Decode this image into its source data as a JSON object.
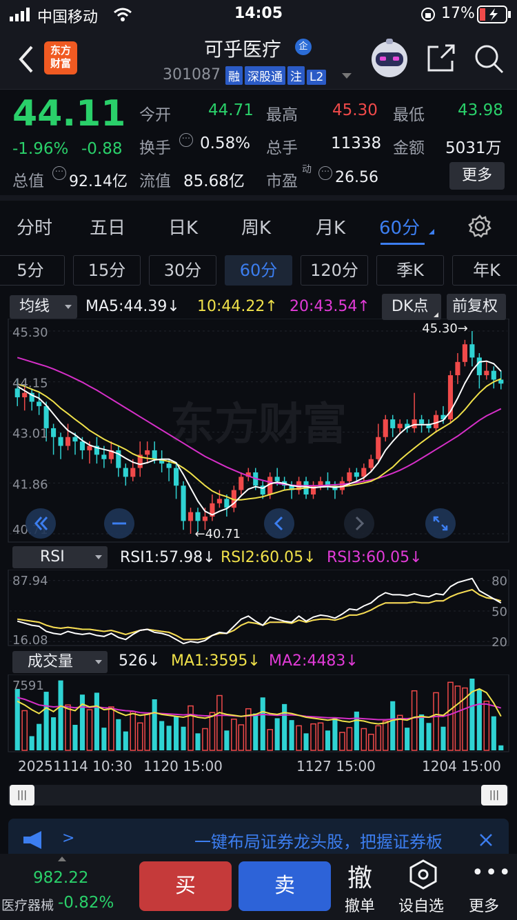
{
  "status_bar": {
    "carrier": "中国移动",
    "time": "14:05",
    "battery": "17%"
  },
  "header": {
    "back_icon": "chevron-left-icon",
    "logo_text": "东方\n财富",
    "stock_name": "可乎医疗",
    "name_badge": "企",
    "stock_code": "301087",
    "badges": [
      "融",
      "深股通",
      "注",
      "L2"
    ]
  },
  "quote": {
    "price": "44.11",
    "change_pct": "-1.96%",
    "change_amt": "-0.88",
    "fields": [
      {
        "label": "今开",
        "value": "44.71",
        "color": "green"
      },
      {
        "label": "最高",
        "value": "45.30",
        "color": "red"
      },
      {
        "label": "最低",
        "value": "43.98",
        "color": "green"
      },
      {
        "label": "换手",
        "value": "0.58%",
        "color": "white"
      },
      {
        "label": "总手",
        "value": "11338",
        "color": "white"
      },
      {
        "label": "金额",
        "value": "5031万",
        "color": "white"
      },
      {
        "label": "总值",
        "value": "92.14亿",
        "color": "white"
      },
      {
        "label": "流值",
        "value": "85.68亿",
        "color": "white"
      },
      {
        "label": "市盈",
        "sup": "动",
        "value": "26.56",
        "color": "white"
      }
    ],
    "more_label": "更多"
  },
  "period_tabs": [
    "分时",
    "五日",
    "日K",
    "周K",
    "月K",
    "60分"
  ],
  "minute_tabs": [
    "5分",
    "15分",
    "30分",
    "60分",
    "120分",
    "季K",
    "年K"
  ],
  "ma_bar": {
    "selector": "均线",
    "ma5": "MA5:44.39↓",
    "ma10": "10:44.22↑",
    "ma20": "20:43.54↑",
    "dk_label": "DK点",
    "adj_label": "前复权"
  },
  "rsi_bar": {
    "selector": "RSI",
    "rsi1": "RSI1:57.98↓",
    "rsi2": "RSI2:60.05↓",
    "rsi3": "RSI3:60.05↓"
  },
  "vol_bar": {
    "selector": "成交量",
    "vol": "526↓",
    "ma1": "MA1:3595↓",
    "ma2": "MA2:4483↓"
  },
  "watermark": "东方财富",
  "colors": {
    "up": "#f04a4a",
    "down": "#2fd3d3",
    "ma5": "#ffffff",
    "ma10": "#f0e14a",
    "ma20": "#d62fc8",
    "accent": "#3c7ef0"
  },
  "chart_data": [
    {
      "type": "candlestick",
      "title": "",
      "y_ticks": [
        "45.30",
        "44.15",
        "43.01",
        "41.86",
        "40.71"
      ],
      "ylim": [
        40.71,
        45.3
      ],
      "high_marker": "45.30→",
      "low_marker": "←40.71",
      "x_tick_labels": [
        "20251114 10:30",
        "1120 15:00",
        "1127 15:00",
        "1204 15:00"
      ],
      "candles": [
        [
          44.0,
          43.8,
          44.2,
          43.6
        ],
        [
          43.8,
          43.9,
          44.05,
          43.5
        ],
        [
          43.9,
          43.7,
          44.0,
          43.5
        ],
        [
          43.7,
          43.6,
          43.9,
          43.4
        ],
        [
          43.6,
          43.1,
          43.7,
          42.8
        ],
        [
          43.1,
          42.9,
          43.2,
          42.5
        ],
        [
          42.9,
          42.7,
          43.0,
          42.4
        ],
        [
          42.7,
          42.9,
          43.2,
          42.6
        ],
        [
          42.9,
          42.8,
          43.0,
          42.5
        ],
        [
          42.8,
          42.6,
          42.9,
          42.4
        ],
        [
          42.6,
          42.7,
          42.8,
          42.3
        ],
        [
          42.7,
          42.5,
          42.9,
          42.3
        ],
        [
          42.5,
          42.4,
          42.7,
          42.2
        ],
        [
          42.4,
          42.6,
          42.8,
          42.3
        ],
        [
          42.6,
          42.2,
          42.7,
          42.0
        ],
        [
          42.2,
          42.0,
          42.3,
          41.8
        ],
        [
          42.0,
          42.2,
          42.4,
          41.9
        ],
        [
          42.2,
          42.5,
          42.8,
          42.0
        ],
        [
          42.5,
          42.6,
          42.8,
          42.3
        ],
        [
          42.6,
          42.4,
          42.8,
          42.3
        ],
        [
          42.4,
          42.3,
          42.6,
          42.1
        ],
        [
          42.3,
          42.2,
          42.4,
          41.9
        ],
        [
          42.2,
          41.8,
          42.3,
          41.5
        ],
        [
          41.8,
          41.0,
          41.9,
          40.8
        ],
        [
          41.0,
          41.2,
          41.3,
          40.71
        ],
        [
          41.2,
          41.0,
          41.3,
          40.75
        ],
        [
          41.0,
          41.1,
          41.3,
          40.8
        ],
        [
          41.1,
          41.4,
          41.6,
          41.0
        ],
        [
          41.4,
          41.5,
          41.7,
          41.3
        ],
        [
          41.5,
          41.3,
          41.6,
          41.1
        ],
        [
          41.3,
          41.7,
          41.8,
          41.2
        ],
        [
          41.7,
          42.0,
          42.1,
          41.6
        ],
        [
          42.0,
          42.1,
          42.2,
          41.9
        ],
        [
          42.1,
          41.8,
          42.2,
          41.7
        ],
        [
          41.8,
          41.6,
          41.9,
          41.5
        ],
        [
          41.6,
          42.0,
          42.1,
          41.5
        ],
        [
          42.0,
          41.9,
          42.2,
          41.8
        ],
        [
          41.9,
          41.8,
          42.0,
          41.7
        ],
        [
          41.8,
          41.7,
          41.9,
          41.5
        ],
        [
          41.7,
          41.9,
          42.0,
          41.6
        ],
        [
          41.9,
          41.6,
          42.0,
          41.5
        ],
        [
          41.6,
          41.8,
          41.9,
          41.5
        ],
        [
          41.8,
          41.9,
          42.0,
          41.7
        ],
        [
          41.9,
          41.8,
          42.1,
          41.7
        ],
        [
          41.8,
          41.7,
          41.9,
          41.5
        ],
        [
          41.7,
          41.9,
          42.0,
          41.6
        ],
        [
          41.9,
          42.1,
          42.2,
          41.8
        ],
        [
          42.1,
          42.0,
          42.2,
          41.9
        ],
        [
          42.0,
          42.2,
          42.3,
          41.9
        ],
        [
          42.2,
          42.4,
          42.5,
          42.1
        ],
        [
          42.4,
          42.9,
          43.2,
          42.3
        ],
        [
          42.9,
          43.3,
          43.4,
          42.8
        ],
        [
          43.3,
          43.1,
          43.4,
          42.9
        ],
        [
          43.1,
          43.2,
          43.3,
          43.0
        ],
        [
          43.2,
          43.1,
          43.3,
          43.0
        ],
        [
          43.1,
          43.3,
          43.9,
          43.0
        ],
        [
          43.3,
          43.2,
          43.4,
          43.0
        ],
        [
          43.2,
          43.1,
          43.3,
          43.0
        ],
        [
          43.1,
          43.4,
          43.5,
          43.0
        ],
        [
          43.4,
          43.3,
          43.6,
          43.2
        ],
        [
          43.3,
          44.3,
          44.4,
          43.2
        ],
        [
          44.3,
          44.6,
          44.8,
          44.1
        ],
        [
          44.6,
          45.0,
          45.1,
          44.5
        ],
        [
          45.0,
          44.7,
          45.3,
          44.5
        ],
        [
          44.7,
          44.3,
          44.8,
          44.0
        ],
        [
          44.3,
          44.4,
          44.6,
          44.2
        ],
        [
          44.4,
          44.2,
          44.5,
          44.0
        ],
        [
          44.2,
          44.11,
          44.4,
          43.98
        ]
      ],
      "ma5": [
        44.05,
        43.95,
        43.85,
        43.78,
        43.62,
        43.42,
        43.22,
        43.05,
        42.95,
        42.82,
        42.72,
        42.66,
        42.62,
        42.58,
        42.52,
        42.42,
        42.33,
        42.28,
        42.32,
        42.38,
        42.4,
        42.4,
        42.32,
        42.05,
        41.75,
        41.45,
        41.22,
        41.14,
        41.22,
        41.28,
        41.4,
        41.57,
        41.72,
        41.78,
        41.74,
        41.84,
        41.88,
        41.85,
        41.8,
        41.78,
        41.78,
        41.75,
        41.77,
        41.78,
        41.76,
        41.78,
        41.84,
        41.9,
        41.98,
        42.12,
        42.32,
        42.6,
        42.8,
        42.98,
        43.12,
        43.18,
        43.18,
        43.18,
        43.22,
        43.28,
        43.48,
        43.78,
        44.12,
        44.4,
        44.6,
        44.62,
        44.56,
        44.39
      ],
      "ma10": [
        44.1,
        44.05,
        43.98,
        43.92,
        43.82,
        43.7,
        43.55,
        43.43,
        43.3,
        43.18,
        43.05,
        42.95,
        42.85,
        42.77,
        42.7,
        42.62,
        42.52,
        42.45,
        42.42,
        42.4,
        42.38,
        42.35,
        42.3,
        42.2,
        42.08,
        41.94,
        41.8,
        41.68,
        41.6,
        41.55,
        41.48,
        41.48,
        41.5,
        41.52,
        41.55,
        41.6,
        41.65,
        41.7,
        41.72,
        41.73,
        41.75,
        41.76,
        41.77,
        41.78,
        41.78,
        41.78,
        41.8,
        41.83,
        41.86,
        41.9,
        41.98,
        42.1,
        42.22,
        42.38,
        42.52,
        42.65,
        42.78,
        42.9,
        43.02,
        43.12,
        43.22,
        43.35,
        43.52,
        43.72,
        43.9,
        44.05,
        44.15,
        44.22
      ],
      "ma20": [
        44.7,
        44.65,
        44.6,
        44.55,
        44.5,
        44.44,
        44.37,
        44.3,
        44.22,
        44.14,
        44.05,
        43.96,
        43.86,
        43.76,
        43.66,
        43.56,
        43.46,
        43.36,
        43.26,
        43.16,
        43.06,
        42.96,
        42.86,
        42.76,
        42.66,
        42.56,
        42.46,
        42.38,
        42.3,
        42.22,
        42.15,
        42.08,
        42.02,
        41.96,
        41.92,
        41.88,
        41.85,
        41.83,
        41.81,
        41.8,
        41.8,
        41.8,
        41.8,
        41.81,
        41.82,
        41.83,
        41.85,
        41.87,
        41.9,
        41.93,
        41.97,
        42.02,
        42.08,
        42.15,
        42.23,
        42.32,
        42.42,
        42.52,
        42.62,
        42.72,
        42.82,
        42.92,
        43.04,
        43.16,
        43.28,
        43.38,
        43.46,
        43.54
      ]
    },
    {
      "type": "line",
      "title": "",
      "y_ticks": [
        "87.94",
        "16.08"
      ],
      "right_ticks": [
        "80",
        "50",
        "20"
      ],
      "ylim": [
        16.08,
        87.94
      ],
      "series": [
        {
          "name": "RSI1",
          "values": [
            40,
            38,
            36,
            35,
            30,
            28,
            27,
            30,
            28,
            27,
            28,
            26,
            25,
            28,
            24,
            22,
            27,
            31,
            32,
            29,
            28,
            26,
            22,
            18,
            20,
            19,
            21,
            26,
            29,
            28,
            35,
            42,
            45,
            40,
            36,
            44,
            42,
            40,
            39,
            45,
            40,
            44,
            46,
            45,
            43,
            47,
            52,
            51,
            55,
            58,
            64,
            68,
            66,
            66,
            65,
            67,
            65,
            64,
            67,
            66,
            74,
            78,
            80,
            82,
            70,
            66,
            62,
            58
          ]
        },
        {
          "name": "RSI2",
          "values": [
            42,
            41,
            40,
            39,
            36,
            34,
            33,
            34,
            33,
            32,
            32,
            31,
            30,
            31,
            29,
            27,
            29,
            31,
            32,
            31,
            30,
            29,
            26,
            22,
            22,
            22,
            23,
            26,
            28,
            28,
            31,
            36,
            39,
            38,
            36,
            39,
            39,
            39,
            38,
            41,
            39,
            41,
            42,
            42,
            41,
            43,
            46,
            46,
            48,
            51,
            55,
            58,
            58,
            58,
            58,
            59,
            58,
            58,
            60,
            60,
            64,
            67,
            69,
            71,
            66,
            63,
            62,
            60
          ]
        },
        {
          "name": "RSI3",
          "values": [
            42,
            41,
            40,
            39,
            36,
            34,
            33,
            34,
            33,
            32,
            32,
            31,
            30,
            31,
            29,
            27,
            29,
            31,
            32,
            31,
            30,
            29,
            26,
            22,
            22,
            22,
            23,
            26,
            28,
            28,
            31,
            36,
            39,
            38,
            36,
            39,
            39,
            39,
            38,
            41,
            39,
            41,
            42,
            42,
            41,
            43,
            46,
            46,
            48,
            51,
            55,
            58,
            58,
            58,
            58,
            59,
            58,
            58,
            60,
            60,
            64,
            67,
            69,
            71,
            66,
            63,
            62,
            60
          ]
        }
      ]
    },
    {
      "type": "bar",
      "title": "",
      "y_ticks": [
        "7591"
      ],
      "ylim": [
        0,
        7591
      ],
      "volume": [
        6500,
        4200,
        1500,
        2800,
        6200,
        3500,
        7400,
        4800,
        2700,
        5900,
        4300,
        6100,
        2400,
        4600,
        3300,
        2000,
        4100,
        2900,
        3800,
        5400,
        3100,
        2600,
        3600,
        2500,
        4700,
        1800,
        2300,
        4000,
        5800,
        2100,
        3300,
        2700,
        4400,
        3900,
        5600,
        2200,
        3400,
        4900,
        3200,
        2600,
        1800,
        2800,
        2900,
        2100,
        3500,
        1900,
        2400,
        4100,
        2300,
        1700,
        2600,
        3100,
        5200,
        3700,
        2400,
        6300,
        3800,
        2900,
        6100,
        2500,
        7200,
        6800,
        6600,
        7591,
        6400,
        5200,
        3600,
        526
      ],
      "ma1": [
        5200,
        4800,
        4300,
        3900,
        4500,
        4100,
        4700,
        4400,
        4200,
        4900,
        4600,
        4700,
        4300,
        4400,
        4000,
        3700,
        3900,
        3700,
        3800,
        4000,
        3800,
        3700,
        3600,
        3500,
        3700,
        3500,
        3400,
        3600,
        4000,
        3800,
        3700,
        3600,
        3700,
        3800,
        4100,
        3900,
        3800,
        4000,
        3900,
        3700,
        3500,
        3400,
        3300,
        3200,
        3300,
        3100,
        3000,
        3200,
        3100,
        2900,
        2800,
        2900,
        3200,
        3300,
        3200,
        3500,
        3600,
        3500,
        3800,
        3700,
        4300,
        4900,
        5500,
        6200,
        6500,
        6100,
        5000,
        3595
      ],
      "ma2": [
        5600,
        5400,
        5100,
        4800,
        4700,
        4600,
        4650,
        4600,
        4500,
        4600,
        4550,
        4600,
        4500,
        4450,
        4300,
        4200,
        4150,
        4000,
        3950,
        3950,
        3900,
        3850,
        3800,
        3750,
        3800,
        3700,
        3650,
        3650,
        3700,
        3700,
        3650,
        3600,
        3650,
        3700,
        3800,
        3750,
        3700,
        3750,
        3750,
        3700,
        3600,
        3550,
        3500,
        3450,
        3450,
        3400,
        3350,
        3400,
        3350,
        3300,
        3250,
        3250,
        3300,
        3350,
        3350,
        3450,
        3500,
        3500,
        3600,
        3600,
        3800,
        4100,
        4400,
        4700,
        4900,
        4900,
        4700,
        4483
      ]
    }
  ],
  "ad_text": "一键布局证券龙头股，把握证券板",
  "bottom": {
    "index_value": "982.22",
    "index_name": "医疗器械",
    "index_change": "-0.82%",
    "buy": "买",
    "sell": "卖",
    "actions": [
      {
        "icon_char": "撤",
        "label": "撤单"
      },
      {
        "icon_char": "",
        "label": "设自选"
      },
      {
        "icon_char": "",
        "label": "更多"
      }
    ]
  }
}
